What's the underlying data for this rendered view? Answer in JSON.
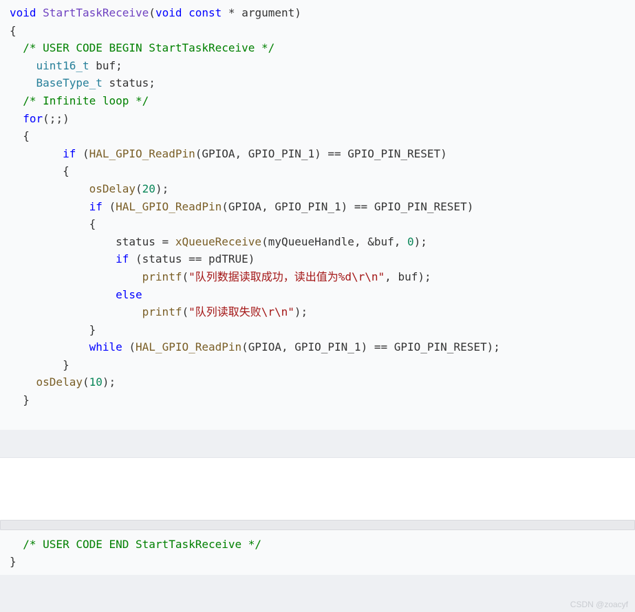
{
  "code": {
    "l1a": "void",
    "l1b": "StartTaskReceive",
    "l1c": "void",
    "l1d": "const",
    "l1e": "argument",
    "c2": "/* USER CODE BEGIN StartTaskReceive */",
    "t_uint16": "uint16_t",
    "v_buf": "buf",
    "t_basetype": "BaseType_t",
    "v_status": "status",
    "c3": "/* Infinite loop */",
    "kw_for": "for",
    "kw_if": "if",
    "kw_else": "else",
    "kw_while": "while",
    "fn_readpin": "HAL_GPIO_ReadPin",
    "arg_gpioa": "GPIOA",
    "arg_pin1": "GPIO_PIN_1",
    "val_reset": "GPIO_PIN_RESET",
    "fn_osdelay": "osDelay",
    "n20": "20",
    "n10": "10",
    "n0": "0",
    "fn_xqr": "xQueueReceive",
    "arg_qh": "myQueueHandle",
    "amp_buf": "&buf",
    "val_pdtrue": "pdTRUE",
    "fn_printf": "printf",
    "str_ok": "\"队列数据读取成功，读出值为%d\\r\\n\"",
    "str_fail": "\"队列读取失败\\r\\n\"",
    "c_end": "/* USER CODE END StartTaskReceive */"
  },
  "watermark": "CSDN @zoacyf"
}
